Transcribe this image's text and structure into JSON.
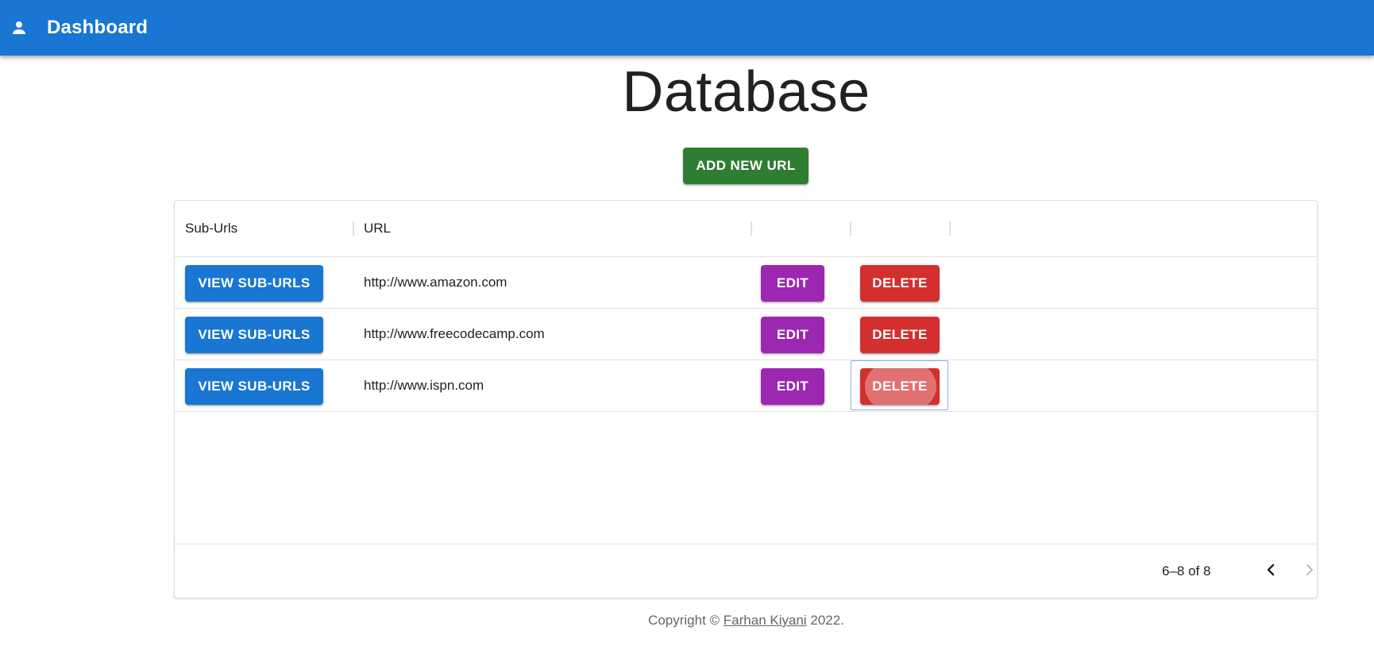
{
  "appbar": {
    "title": "Dashboard",
    "icon": "person-icon",
    "color": "#1976d2"
  },
  "page": {
    "title": "Database"
  },
  "toolbar": {
    "add_label": "ADD NEW URL",
    "add_color": "#2e7d32"
  },
  "table": {
    "columns": [
      "Sub-Urls",
      "URL",
      "",
      ""
    ],
    "rows": [
      {
        "view_label": "VIEW SUB-URLS",
        "url": "http://www.amazon.com",
        "edit_label": "EDIT",
        "delete_label": "DELETE"
      },
      {
        "view_label": "VIEW SUB-URLS",
        "url": "http://www.freecodecamp.com",
        "edit_label": "EDIT",
        "delete_label": "DELETE"
      },
      {
        "view_label": "VIEW SUB-URLS",
        "url": "http://www.ispn.com",
        "edit_label": "EDIT",
        "delete_label": "DELETE"
      }
    ],
    "colors": {
      "view": "#1976d2",
      "edit": "#9c27b0",
      "delete": "#d32f2f"
    }
  },
  "pagination": {
    "range": "6–8 of 8",
    "prev_icon": "chevron-left-icon",
    "next_icon": "chevron-right-icon",
    "next_disabled": true
  },
  "footer": {
    "prefix": "Copyright © ",
    "author": "Farhan Kiyani",
    "suffix": " 2022."
  }
}
